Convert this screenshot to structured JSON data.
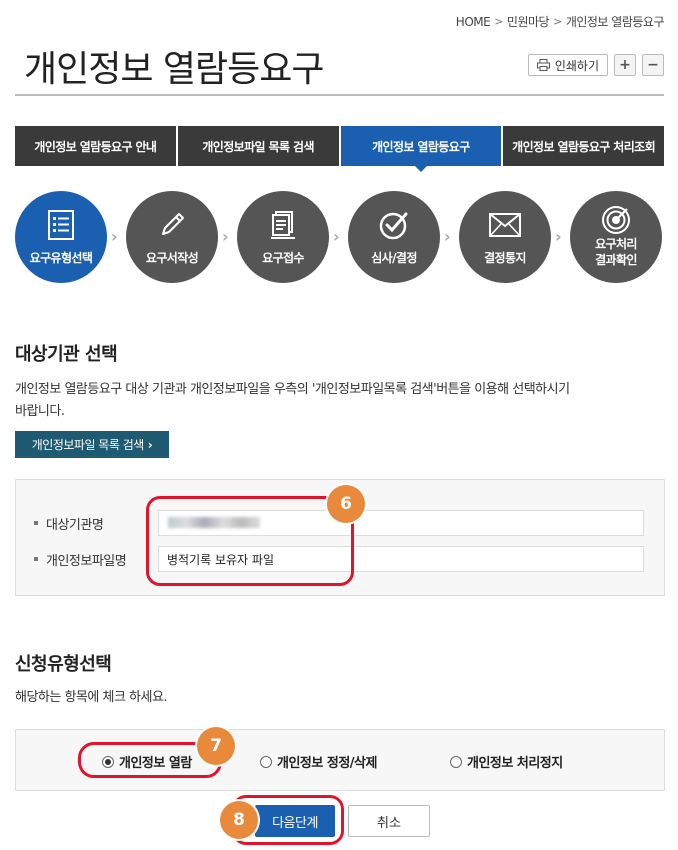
{
  "breadcrumb": [
    "HOME",
    "민원마당",
    "개인정보 열람등요구"
  ],
  "page_title": "개인정보 열람등요구",
  "tools": {
    "print_label": "인쇄하기",
    "zoom_in": "+",
    "zoom_out": "−"
  },
  "tabs": [
    {
      "label": "개인정보 열람등요구 안내"
    },
    {
      "label": "개인정보파일 목록 검색"
    },
    {
      "label": "개인정보 열람등요구"
    },
    {
      "label": "개인정보 열람등요구 처리조회"
    }
  ],
  "steps": [
    {
      "label": "요구유형선택",
      "icon": "list-icon"
    },
    {
      "label": "요구서작성",
      "icon": "pencil-icon"
    },
    {
      "label": "요구접수",
      "icon": "document-icon"
    },
    {
      "label": "심사/결정",
      "icon": "check-circle-icon"
    },
    {
      "label": "결정통지",
      "icon": "envelope-icon"
    },
    {
      "label_line1": "요구처리",
      "label_line2": "결과확인",
      "icon": "target-icon"
    }
  ],
  "target": {
    "title": "대상기관 선택",
    "desc_line1": "개인정보 열람등요구 대상 기관과 개인정보파일을 우측의 '개인정보파일목록 검색'버튼을 이용해 선택하시기",
    "desc_line2": "바랍니다.",
    "search_button": "개인정보파일 목록 검색",
    "fields": {
      "agency_label": "대상기관명",
      "agency_value": "",
      "file_label": "개인정보파일명",
      "file_value": "병적기록 보유자 파일"
    }
  },
  "request_type": {
    "title": "신청유형선택",
    "desc": "해당하는 항목에 체크 하세요.",
    "options": [
      {
        "label": "개인정보 열람",
        "checked": true
      },
      {
        "label": "개인정보 정정/삭제",
        "checked": false
      },
      {
        "label": "개인정보 처리정지",
        "checked": false
      }
    ]
  },
  "buttons": {
    "next": "다음단계",
    "cancel": "취소"
  },
  "annotations": {
    "badge_6": "6",
    "badge_7": "7",
    "badge_8": "8"
  },
  "colors": {
    "accent": "#1a5fb0",
    "dark_tab": "#3a3a3a",
    "annotation": "#e0142a",
    "badge": "#e8893b",
    "search_btn": "#1e5b73"
  }
}
